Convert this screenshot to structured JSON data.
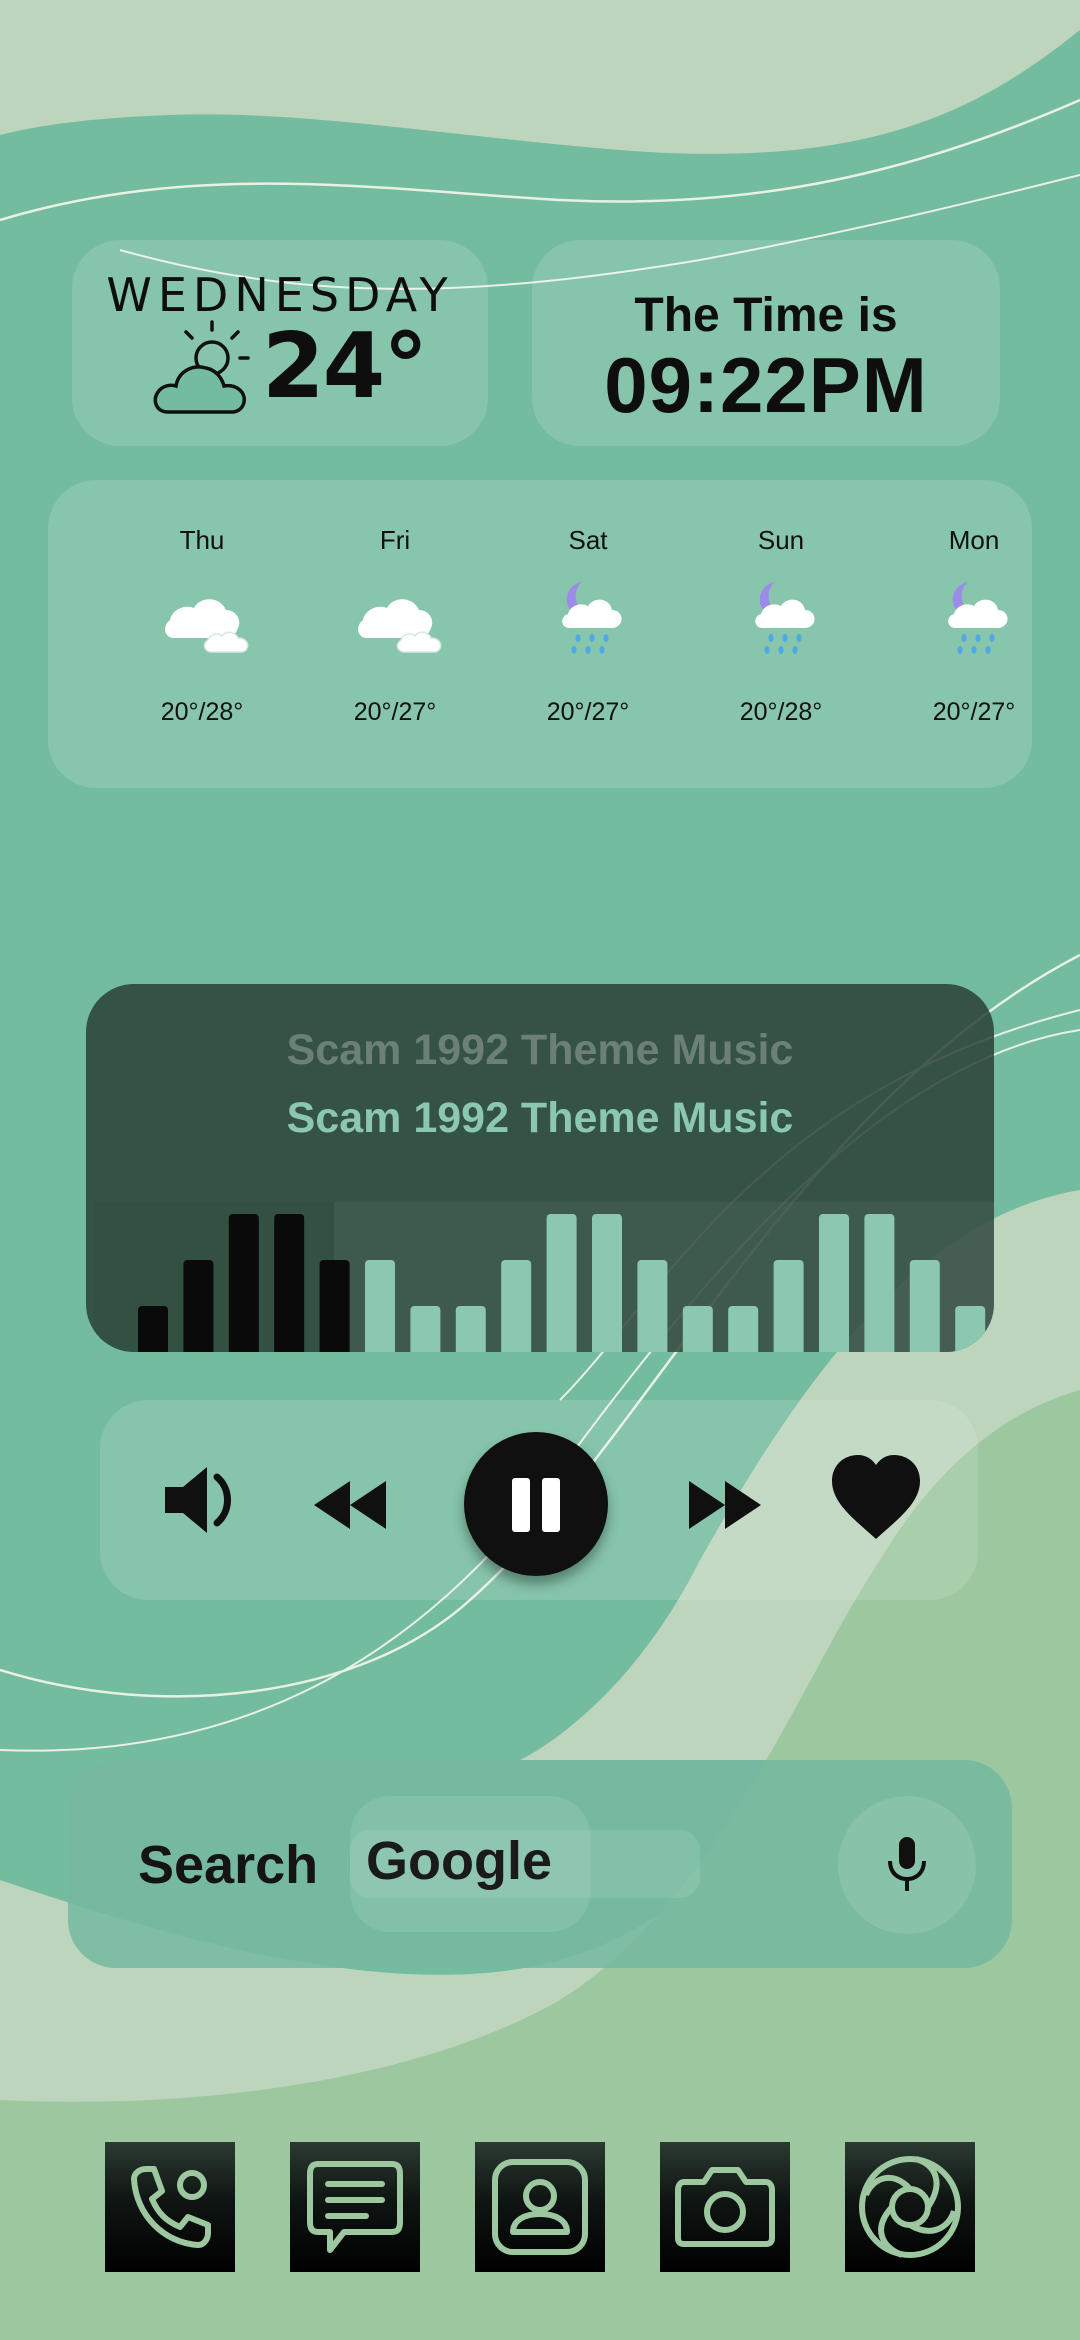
{
  "colors": {
    "background": "#74bc9f",
    "light_wave": "#bdd5bd",
    "lower_wave": "#9cc79f",
    "card_tint": "rgba(255,255,255,0.13)",
    "music_card": "#2f4a3f",
    "accent_mint": "#8cc8b0",
    "icon_black": "#101010",
    "moon_purple": "#9c8be8",
    "rain_blue": "#4fa8e6"
  },
  "weather": {
    "day": "WEDNESDAY",
    "temperature": "24°",
    "icon": "partly-cloudy-icon"
  },
  "clock": {
    "label": "The Time is",
    "time": "09:22PM"
  },
  "forecast": [
    {
      "day": "Thu",
      "temps": "20°/28°",
      "icon": "cloudy-icon"
    },
    {
      "day": "Fri",
      "temps": "20°/27°",
      "icon": "cloudy-icon"
    },
    {
      "day": "Sat",
      "temps": "20°/27°",
      "icon": "night-rain-icon"
    },
    {
      "day": "Sun",
      "temps": "20°/28°",
      "icon": "night-rain-icon"
    },
    {
      "day": "Mon",
      "temps": "20°/27°",
      "icon": "night-rain-icon"
    }
  ],
  "music": {
    "title_faded": "Scam 1992 Theme Music",
    "title": "Scam 1992 Theme Music",
    "equalizer_levels": [
      1,
      2,
      3,
      3,
      2,
      2,
      1,
      1,
      2,
      3,
      3,
      2,
      1,
      1,
      2,
      3,
      3,
      2,
      1
    ],
    "played_bars": 5
  },
  "controls": {
    "volume_icon": "volume-icon",
    "previous_icon": "rewind-icon",
    "play_state_icon": "pause-icon",
    "next_icon": "fast-forward-icon",
    "favorite_icon": "heart-icon"
  },
  "search": {
    "label": "Search",
    "provider": "Google",
    "mic_icon": "microphone-icon"
  },
  "dock": [
    {
      "name": "phone",
      "icon": "phone-icon"
    },
    {
      "name": "messages",
      "icon": "message-icon"
    },
    {
      "name": "contacts",
      "icon": "contacts-icon"
    },
    {
      "name": "camera",
      "icon": "camera-icon"
    },
    {
      "name": "browser",
      "icon": "browser-icon"
    }
  ]
}
